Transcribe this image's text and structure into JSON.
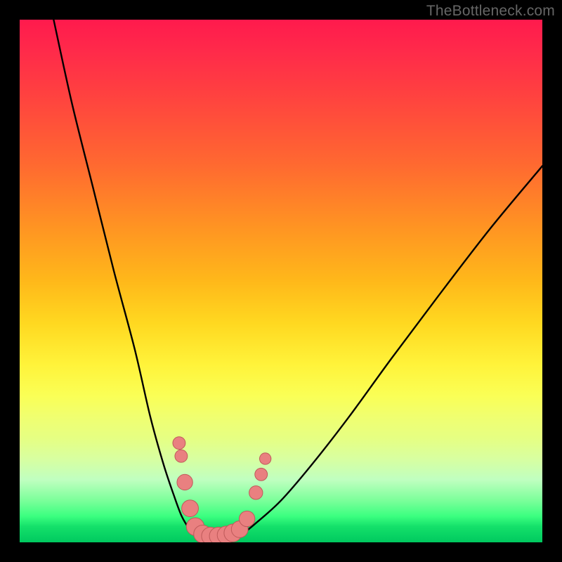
{
  "watermark": {
    "text": "TheBottleneck.com"
  },
  "colors": {
    "frame": "#000000",
    "curve_stroke": "#000000",
    "marker_fill": "#e98080",
    "marker_stroke": "#bf5a5a"
  },
  "chart_data": {
    "type": "line",
    "title": "",
    "xlabel": "",
    "ylabel": "",
    "xlim": [
      0,
      100
    ],
    "ylim": [
      0,
      100
    ],
    "grid": false,
    "legend": false,
    "series": [
      {
        "name": "left-branch",
        "x": [
          6.5,
          10,
          14,
          18,
          22,
          25,
          27.5,
          29.5,
          31,
          32.5,
          33.5
        ],
        "y": [
          100,
          84,
          68,
          52,
          37,
          24,
          15,
          9,
          5,
          2.5,
          1.5
        ]
      },
      {
        "name": "valley-floor",
        "x": [
          33.5,
          35,
          37,
          39,
          41,
          42.5
        ],
        "y": [
          1.5,
          0.9,
          0.7,
          0.7,
          0.9,
          1.5
        ]
      },
      {
        "name": "right-branch",
        "x": [
          42.5,
          45,
          50,
          56,
          63,
          71,
          80,
          90,
          100
        ],
        "y": [
          1.5,
          3.5,
          8,
          15,
          24,
          35,
          47,
          60,
          72
        ]
      }
    ],
    "markers": [
      {
        "x": 30.5,
        "y": 19,
        "r": 1.2
      },
      {
        "x": 30.9,
        "y": 16.5,
        "r": 1.2
      },
      {
        "x": 31.6,
        "y": 11.5,
        "r": 1.5
      },
      {
        "x": 32.6,
        "y": 6.5,
        "r": 1.6
      },
      {
        "x": 33.6,
        "y": 3.0,
        "r": 1.7
      },
      {
        "x": 35.0,
        "y": 1.6,
        "r": 1.7
      },
      {
        "x": 36.5,
        "y": 1.2,
        "r": 1.7
      },
      {
        "x": 38.0,
        "y": 1.2,
        "r": 1.7
      },
      {
        "x": 39.5,
        "y": 1.4,
        "r": 1.7
      },
      {
        "x": 40.8,
        "y": 1.8,
        "r": 1.7
      },
      {
        "x": 42.1,
        "y": 2.5,
        "r": 1.6
      },
      {
        "x": 43.5,
        "y": 4.5,
        "r": 1.5
      },
      {
        "x": 45.2,
        "y": 9.5,
        "r": 1.3
      },
      {
        "x": 46.2,
        "y": 13.0,
        "r": 1.2
      },
      {
        "x": 47.0,
        "y": 16.0,
        "r": 1.1
      }
    ]
  }
}
